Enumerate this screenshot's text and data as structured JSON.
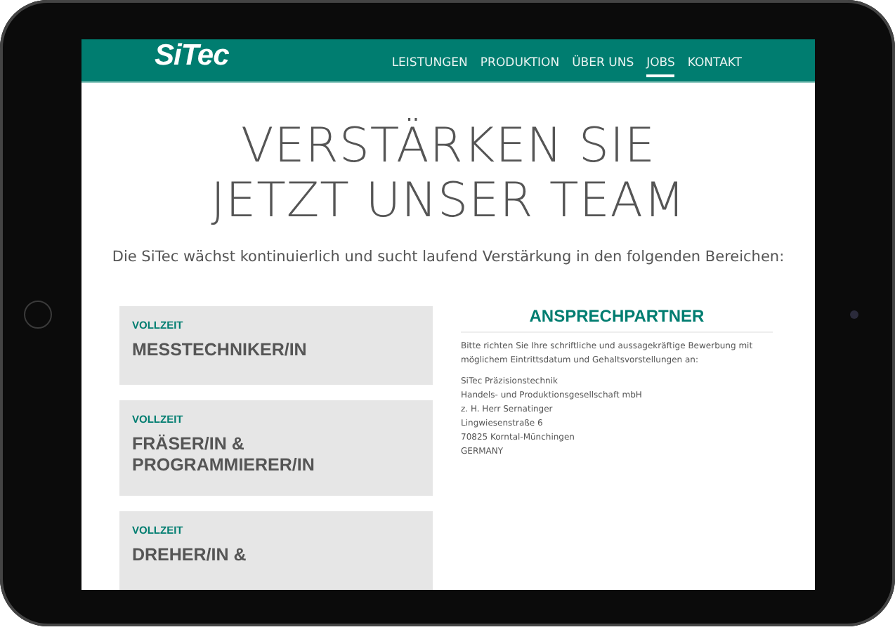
{
  "header": {
    "logo": "SiTec",
    "nav": [
      {
        "label": "LEISTUNGEN",
        "selected": false
      },
      {
        "label": "PRODUKTION",
        "selected": false
      },
      {
        "label": "ÜBER UNS",
        "selected": false
      },
      {
        "label": "JOBS",
        "selected": true
      },
      {
        "label": "KONTAKT",
        "selected": false
      }
    ]
  },
  "hero": {
    "title_lines": [
      "VERSTÄRKEN SIE",
      "JETZT UNSER TEAM"
    ],
    "intro": "Die SiTec wächst kontinuierlich und sucht laufend Verstärkung in den folgenden Bereichen:"
  },
  "jobs": [
    {
      "type": "VOLLZEIT",
      "title": "MESSTECHNIKER/IN"
    },
    {
      "type": "VOLLZEIT",
      "title": "FRÄSER/IN & PROGRAMMIERER/IN"
    },
    {
      "type": "VOLLZEIT",
      "title": "DREHER/IN &"
    }
  ],
  "contact": {
    "heading": "ANSPRECHPARTNER",
    "text": "Bitte richten Sie Ihre schriftliche und aussagekräftige Bewerbung mit möglichem Eintrittsdatum und Gehaltsvorstellungen an:",
    "address": [
      "SiTec Präzisionstechnik",
      "Handels- und Produktionsgesellschaft mbH",
      "z. H. Herr Sernatinger",
      "Lingwiesenstraße 6",
      "70825 Korntal-Münchingen",
      "GERMANY"
    ]
  }
}
